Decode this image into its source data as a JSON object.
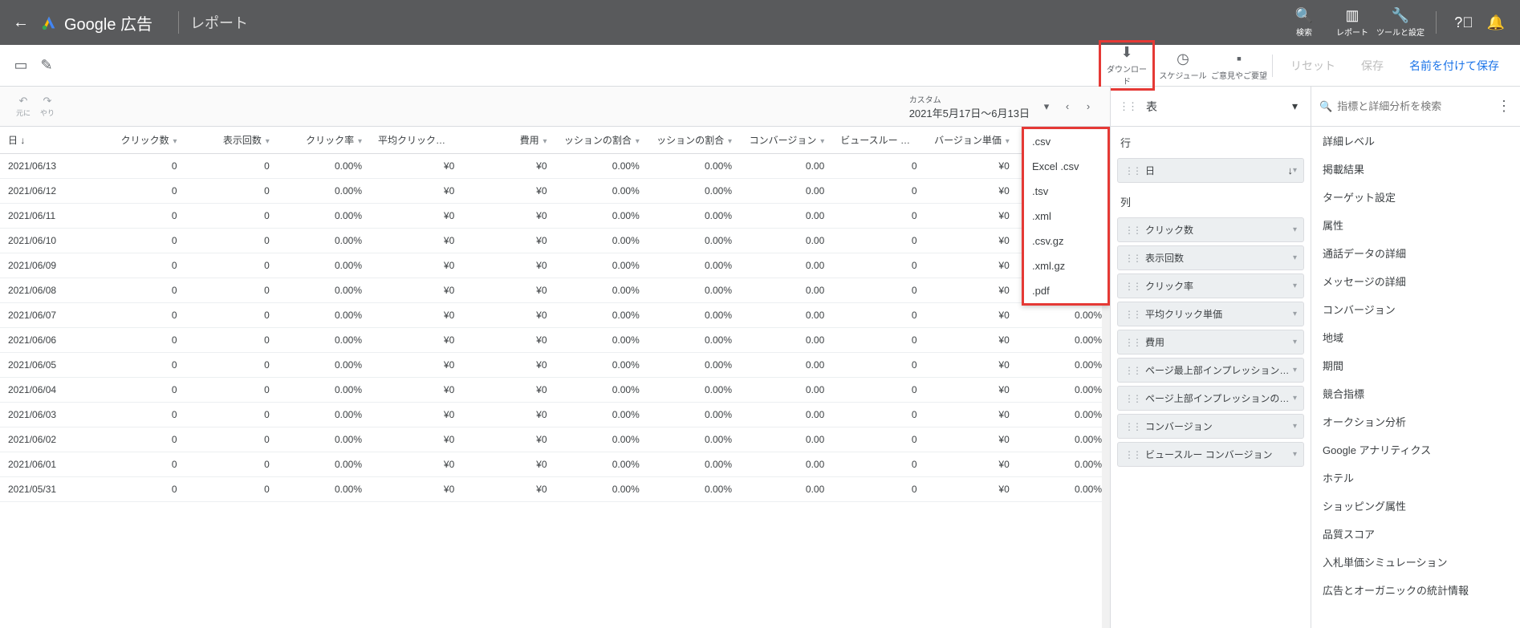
{
  "topbar": {
    "brand": "Google 広告",
    "section": "レポート",
    "tools": [
      {
        "icon": "search",
        "label": "検索"
      },
      {
        "icon": "chart",
        "label": "レポート"
      },
      {
        "icon": "wrench",
        "label": "ツールと設定"
      }
    ]
  },
  "secbar": {
    "actions": [
      {
        "icon": "download",
        "label": "ダウンロード",
        "highlight": true
      },
      {
        "icon": "clock",
        "label": "スケジュール"
      },
      {
        "icon": "feedback",
        "label": "ご意見やご要望"
      }
    ],
    "reset": "リセット",
    "save": "保存",
    "saveas": "名前を付けて保存"
  },
  "ctrl": {
    "undo": "元に",
    "redo": "やり",
    "custom": "カスタム",
    "range": "2021年5月17日～6月13日"
  },
  "downloadMenu": [
    ".csv",
    "Excel .csv",
    ".tsv",
    ".xml",
    ".csv.gz",
    ".xml.gz",
    ".pdf"
  ],
  "columns": [
    "日",
    "クリック数",
    "表示回数",
    "クリック率",
    "平均クリック単価",
    "費用",
    "ッションの割合",
    "ッションの割合",
    "コンバージョン",
    "ビュースルー コンバージョン",
    "バージョン単価",
    ""
  ],
  "rows": [
    [
      "2021/06/13",
      "0",
      "0",
      "0.00%",
      "¥0",
      "¥0",
      "0.00%",
      "0.00%",
      "0.00",
      "0",
      "¥0",
      ""
    ],
    [
      "2021/06/12",
      "0",
      "0",
      "0.00%",
      "¥0",
      "¥0",
      "0.00%",
      "0.00%",
      "0.00",
      "0",
      "¥0",
      ""
    ],
    [
      "2021/06/11",
      "0",
      "0",
      "0.00%",
      "¥0",
      "¥0",
      "0.00%",
      "0.00%",
      "0.00",
      "0",
      "¥0",
      ""
    ],
    [
      "2021/06/10",
      "0",
      "0",
      "0.00%",
      "¥0",
      "¥0",
      "0.00%",
      "0.00%",
      "0.00",
      "0",
      "¥0",
      "0.00%"
    ],
    [
      "2021/06/09",
      "0",
      "0",
      "0.00%",
      "¥0",
      "¥0",
      "0.00%",
      "0.00%",
      "0.00",
      "0",
      "¥0",
      "0.00%"
    ],
    [
      "2021/06/08",
      "0",
      "0",
      "0.00%",
      "¥0",
      "¥0",
      "0.00%",
      "0.00%",
      "0.00",
      "0",
      "¥0",
      "0.00%"
    ],
    [
      "2021/06/07",
      "0",
      "0",
      "0.00%",
      "¥0",
      "¥0",
      "0.00%",
      "0.00%",
      "0.00",
      "0",
      "¥0",
      "0.00%"
    ],
    [
      "2021/06/06",
      "0",
      "0",
      "0.00%",
      "¥0",
      "¥0",
      "0.00%",
      "0.00%",
      "0.00",
      "0",
      "¥0",
      "0.00%"
    ],
    [
      "2021/06/05",
      "0",
      "0",
      "0.00%",
      "¥0",
      "¥0",
      "0.00%",
      "0.00%",
      "0.00",
      "0",
      "¥0",
      "0.00%"
    ],
    [
      "2021/06/04",
      "0",
      "0",
      "0.00%",
      "¥0",
      "¥0",
      "0.00%",
      "0.00%",
      "0.00",
      "0",
      "¥0",
      "0.00%"
    ],
    [
      "2021/06/03",
      "0",
      "0",
      "0.00%",
      "¥0",
      "¥0",
      "0.00%",
      "0.00%",
      "0.00",
      "0",
      "¥0",
      "0.00%"
    ],
    [
      "2021/06/02",
      "0",
      "0",
      "0.00%",
      "¥0",
      "¥0",
      "0.00%",
      "0.00%",
      "0.00",
      "0",
      "¥0",
      "0.00%"
    ],
    [
      "2021/06/01",
      "0",
      "0",
      "0.00%",
      "¥0",
      "¥0",
      "0.00%",
      "0.00%",
      "0.00",
      "0",
      "¥0",
      "0.00%"
    ],
    [
      "2021/05/31",
      "0",
      "0",
      "0.00%",
      "¥0",
      "¥0",
      "0.00%",
      "0.00%",
      "0.00",
      "0",
      "¥0",
      "0.00%"
    ]
  ],
  "mid": {
    "viewType": "表",
    "rowsLabel": "行",
    "rowChip": "日",
    "colsLabel": "列",
    "colChips": [
      "クリック数",
      "表示回数",
      "クリック率",
      "平均クリック単価",
      "費用",
      "ページ最上部インプレッションの...",
      "ページ上部インプレッションの割合",
      "コンバージョン",
      "ビュースルー コンバージョン"
    ]
  },
  "right": {
    "searchPlaceholder": "指標と詳細分析を検索",
    "categories": [
      "詳細レベル",
      "掲載結果",
      "ターゲット設定",
      "属性",
      "通話データの詳細",
      "メッセージの詳細",
      "コンバージョン",
      "地域",
      "期間",
      "競合指標",
      "オークション分析",
      "Google アナリティクス",
      "ホテル",
      "ショッピング属性",
      "品質スコア",
      "入札単価シミュレーション",
      "広告とオーガニックの統計情報"
    ]
  }
}
